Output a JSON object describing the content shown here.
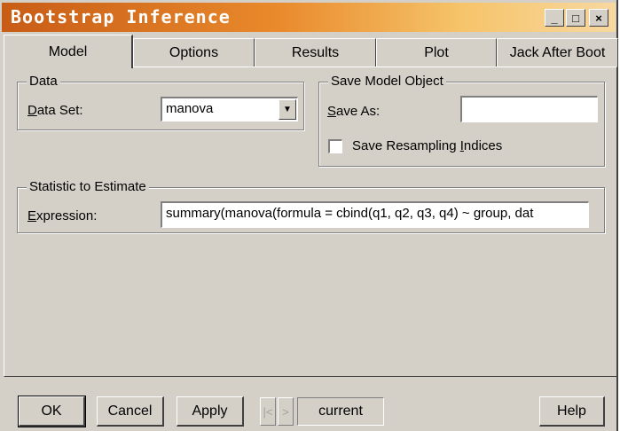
{
  "window": {
    "title": "Bootstrap Inference"
  },
  "title_buttons": {
    "minimize": "_",
    "maximize": "□",
    "close": "×"
  },
  "tabs": [
    {
      "label": "Model",
      "active": true
    },
    {
      "label": "Options",
      "active": false
    },
    {
      "label": "Results",
      "active": false
    },
    {
      "label": "Plot",
      "active": false
    },
    {
      "label": "Jack After Boot",
      "active": false
    }
  ],
  "data_group": {
    "legend": "Data",
    "dataset_label_u": "D",
    "dataset_label_rest": "ata Set:",
    "dataset_value": "manova"
  },
  "save_group": {
    "legend": "Save Model Object",
    "save_as_label_u": "S",
    "save_as_label_rest": "ave As:",
    "save_as_value": "",
    "resample_label_pre": "Save Resampling ",
    "resample_label_u": "I",
    "resample_label_post": "ndices",
    "resample_checked": false
  },
  "statistic_group": {
    "legend": "Statistic to Estimate",
    "expression_label_u": "E",
    "expression_label_rest": "xpression:",
    "expression_value": "summary(manova(formula = cbind(q1, q2, q3, q4) ~ group, dat"
  },
  "buttons": {
    "ok": "OK",
    "cancel": "Cancel",
    "apply": "Apply",
    "prev": "|<",
    "next": ">",
    "status": "current",
    "help": "Help"
  }
}
